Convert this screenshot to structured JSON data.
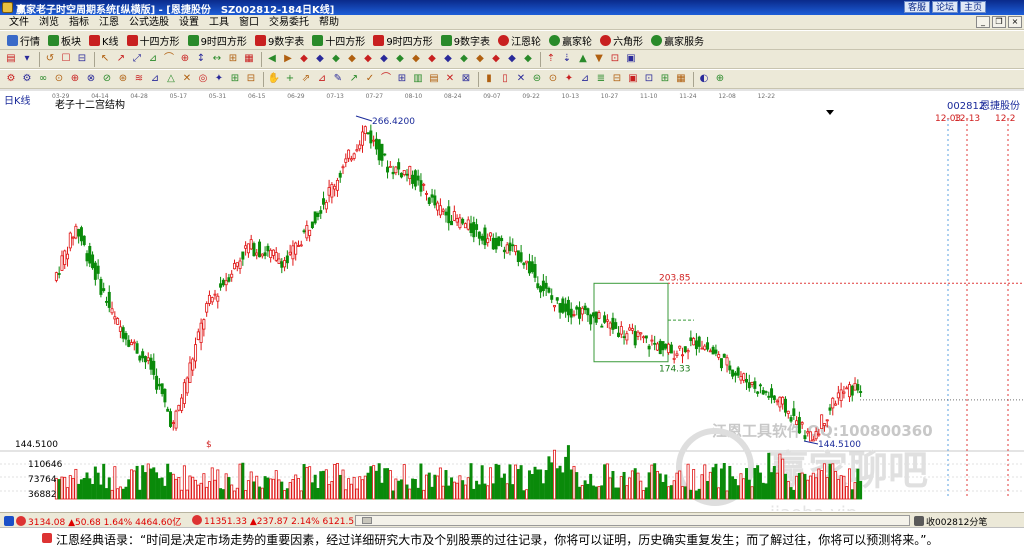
{
  "window": {
    "title": "赢家老子时空周期系统[纵横版] - [恩捷股份　SZ002812-184日K线]",
    "links": [
      "客服",
      "论坛",
      "主页"
    ]
  },
  "menu": [
    "文件",
    "浏览",
    "指标",
    "江恩",
    "公式选股",
    "设置",
    "工具",
    "窗口",
    "交易委托",
    "帮助"
  ],
  "toolbar1": [
    {
      "label": "行情",
      "icon": "grid-icon",
      "color": "#3a6ac8"
    },
    {
      "label": "板块",
      "icon": "blocks-icon",
      "color": "#2a8a2a"
    },
    {
      "label": "K线",
      "icon": "candle-icon",
      "color": "#c82020"
    },
    {
      "label": "十四方形",
      "icon": "square-icon",
      "color": "#c82020"
    },
    {
      "label": "9时四方形",
      "icon": "square-icon",
      "color": "#2a8a2a"
    },
    {
      "label": "9数字表",
      "icon": "table-icon",
      "color": "#c82020"
    },
    {
      "label": "十四方形",
      "icon": "square-icon",
      "color": "#2a8a2a"
    },
    {
      "label": "9时四方形",
      "icon": "square-icon",
      "color": "#c82020"
    },
    {
      "label": "9数字表",
      "icon": "table-icon",
      "color": "#2a8a2a"
    },
    {
      "label": "江恩轮",
      "icon": "wheel-icon",
      "color": "#c82020"
    },
    {
      "label": "赢家轮",
      "icon": "wheel-icon",
      "color": "#2a8a2a"
    },
    {
      "label": "六角形",
      "icon": "hexagon-icon",
      "color": "#c82020"
    },
    {
      "label": "赢家服务",
      "icon": "service-icon",
      "color": "#2a8a2a"
    }
  ],
  "chart": {
    "period_label": "日K线",
    "indicator_title": "老子十二宫结构",
    "stock_code": "002812",
    "stock_name": "恩捷股份",
    "high_label": "266.4200",
    "low_label": "144.5100",
    "box_top_label": "203.85",
    "box_bottom_label": "174.33",
    "left_axis_price": "144.5100",
    "dollar_mark": "$",
    "future_dates": [
      "12-03",
      "12-13",
      "12-2"
    ],
    "volume_ticks": [
      "110646",
      "73764",
      "36882"
    ],
    "watermark_top": "江恩工具软件  QQ:100800360",
    "watermark_logo": "赢家聊吧",
    "watermark_url": "jiaoba.vip"
  },
  "chart_data": {
    "type": "candlestick",
    "x_dates": [
      "03-29",
      "04-14",
      "04-28",
      "05-17",
      "05-31",
      "06-15",
      "06-29",
      "07-13",
      "07-27",
      "08-10",
      "08-24",
      "09-07",
      "09-22",
      "10-13",
      "10-27",
      "11-10",
      "11-24",
      "12-08",
      "12-22"
    ],
    "y_high": 266.42,
    "y_low": 144.51,
    "annotations": [
      203.85,
      174.33
    ],
    "volume_ticks": [
      110646,
      73764,
      36882
    ]
  },
  "status": {
    "index1": "3134.08",
    "index1_change": "▲50.68 1.64% 4464.60亿",
    "index2": "11351.33",
    "index2_change": "▲237.87 2.14% 6121.5",
    "right_text": "收002812分笔"
  },
  "quote": {
    "text": "江恩经典语录：“时间是决定市场走势的重要因素，经过详细研究大市及个别股票的过往记录，你将可以证明，历史确实重复发生；而了解过往，你将可以预测将来。”。"
  },
  "colors": {
    "up": "#e01818",
    "down": "#0a8a0a",
    "title_bg": "#1a4fc8",
    "toolbar_bg": "#ece9d8"
  }
}
